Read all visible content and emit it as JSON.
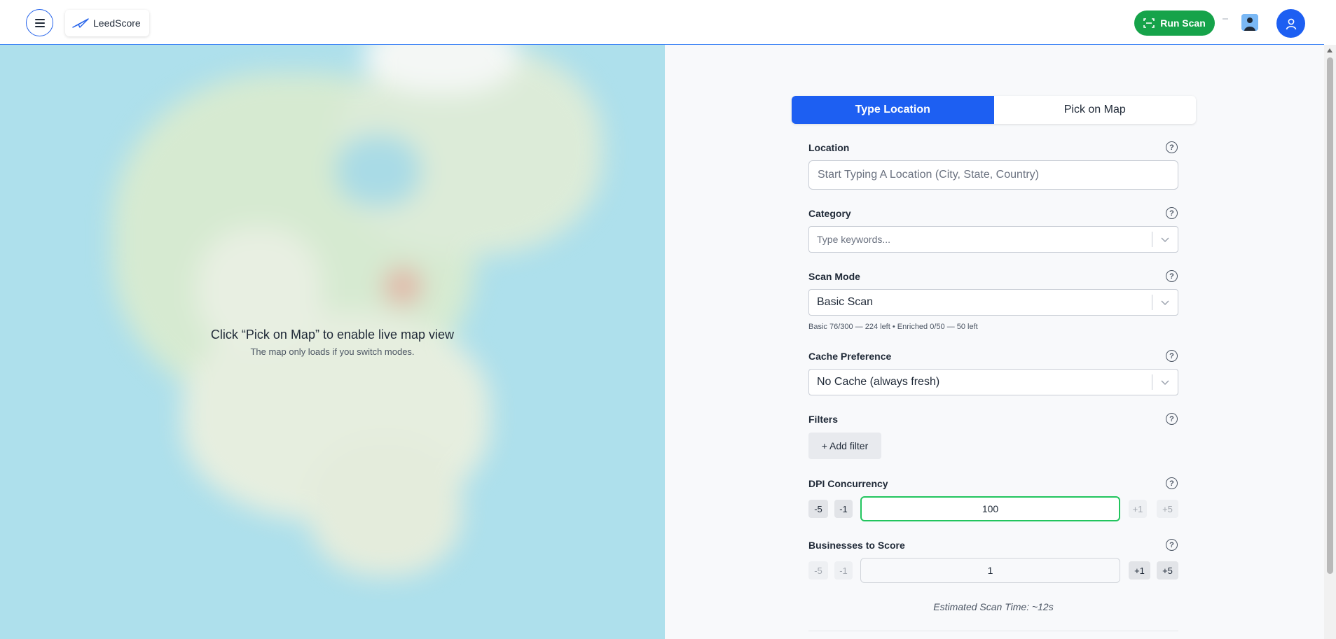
{
  "header": {
    "menu_icon": "hamburger-icon",
    "brand_name": "LeedScore",
    "brand_icon": "paper-plane-icon",
    "run_scan_label": "Run Scan",
    "run_scan_icon": "scan-icon",
    "user_icon": "user-icon"
  },
  "map": {
    "title": "Click “Pick on Map” to enable live map view",
    "subtitle": "The map only loads if you switch modes."
  },
  "tabs": [
    {
      "label": "Type Location",
      "active": true
    },
    {
      "label": "Pick on Map",
      "active": false
    }
  ],
  "form": {
    "location": {
      "label": "Location",
      "placeholder": "Start Typing A Location (City, State, Country)",
      "value": ""
    },
    "category": {
      "label": "Category",
      "placeholder": "Type keywords..."
    },
    "scan_mode": {
      "label": "Scan Mode",
      "value": "Basic Scan",
      "usage": "Basic 76/300 — 224 left • Enriched 0/50 — 50 left"
    },
    "cache": {
      "label": "Cache Preference",
      "value": "No Cache (always fresh)"
    },
    "filters": {
      "label": "Filters",
      "add_label": "+ Add filter"
    },
    "dpi": {
      "label": "DPI Concurrency",
      "value": "100",
      "steps": [
        "-5",
        "-1",
        "+1",
        "+5"
      ]
    },
    "businesses": {
      "label": "Businesses to Score",
      "value": "1",
      "steps": [
        "-5",
        "-1",
        "+1",
        "+5"
      ]
    },
    "help_glyph": "?",
    "estimate": "Estimated Scan Time: ~12s"
  },
  "colors": {
    "accent": "#1d5ff2",
    "success": "#16a34a",
    "focus_ring": "#22c55e"
  }
}
